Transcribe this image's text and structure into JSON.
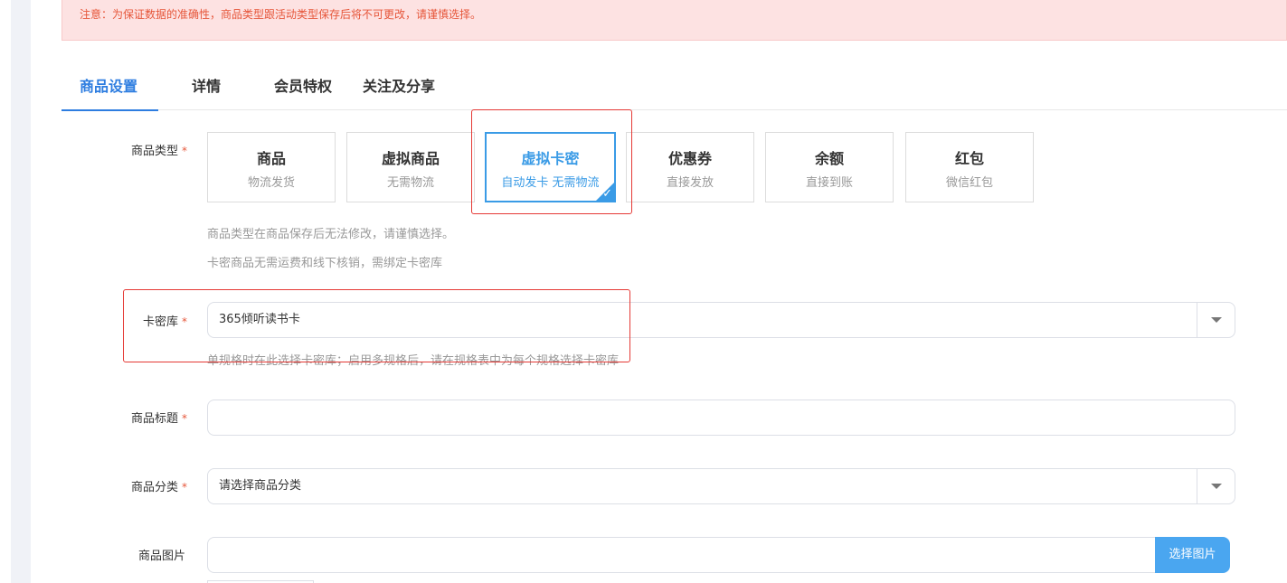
{
  "notice": "注意：为保证数据的准确性，商品类型跟活动类型保存后将不可更改，请谨慎选择。",
  "tabs": [
    "商品设置",
    "详情",
    "会员特权",
    "关注及分享"
  ],
  "form": {
    "required_mark": "*",
    "type_label": "商品类型",
    "types": [
      {
        "title": "商品",
        "sub": "物流发货",
        "selected": false
      },
      {
        "title": "虚拟商品",
        "sub": "无需物流",
        "selected": false
      },
      {
        "title": "虚拟卡密",
        "sub": "自动发卡 无需物流",
        "selected": true
      },
      {
        "title": "优惠券",
        "sub": "直接发放",
        "selected": false
      },
      {
        "title": "余额",
        "sub": "直接到账",
        "selected": false
      },
      {
        "title": "红包",
        "sub": "微信红包",
        "selected": false
      }
    ],
    "type_hint_1": "商品类型在商品保存后无法修改，请谨慎选择。",
    "type_hint_2": "卡密商品无需运费和线下核销，需绑定卡密库",
    "card_lib_label": "卡密库",
    "card_lib_value": "365倾听读书卡",
    "card_lib_hint": "单规格时在此选择卡密库；启用多规格后，请在规格表中为每个规格选择卡密库",
    "title_label": "商品标题",
    "title_value": "",
    "category_label": "商品分类",
    "category_placeholder": "请选择商品分类",
    "image_label": "商品图片",
    "image_button": "选择图片"
  },
  "colors": {
    "accent": "#2d7de0",
    "selected_border": "#3a9be6",
    "required": "#e6563a",
    "highlight_box": "#e53935",
    "notice_bg": "#fde2e2"
  }
}
